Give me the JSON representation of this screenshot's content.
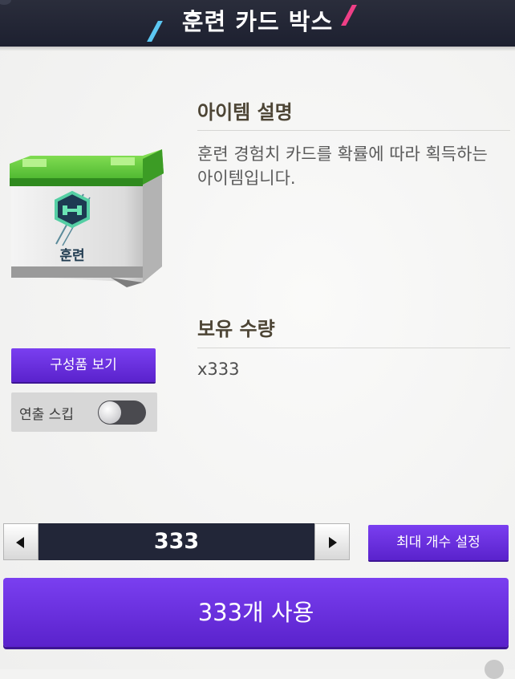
{
  "header": {
    "title": "훈련 카드 박스"
  },
  "item_description": {
    "heading": "아이템 설명",
    "text": "훈련 경험치 카드를 확률에 따라 획득하는 아이템입니다."
  },
  "holdings": {
    "heading": "보유 수량",
    "quantity": "x333"
  },
  "box": {
    "label": "훈련",
    "icon": "dumbbell-icon"
  },
  "buttons": {
    "view_components": "구성품 보기",
    "max_count": "최대 개수 설정",
    "use": "333개 사용"
  },
  "skip": {
    "label": "연출 스킵",
    "enabled": false
  },
  "stepper": {
    "value": "333"
  },
  "colors": {
    "header": "#1f2232",
    "accent_purple": "#6a30e0",
    "stepper_field": "#222638",
    "slash_blue": "#5cc7f2",
    "slash_pink": "#ee3f86",
    "box_green": "#5cc43a"
  }
}
